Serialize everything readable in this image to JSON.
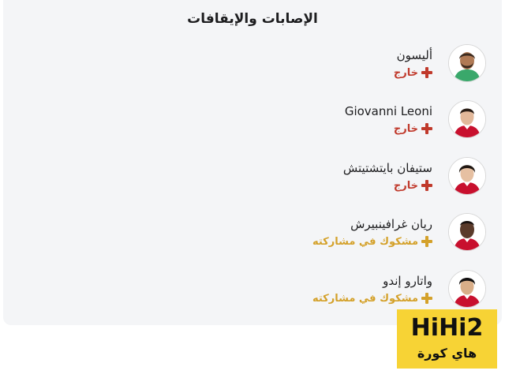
{
  "panel": {
    "title": "الإصابات والإيقافات",
    "players": [
      {
        "name": "أليسون",
        "status": "خارج",
        "status_type": "out",
        "kit": "green"
      },
      {
        "name": "Giovanni Leoni",
        "status": "خارج",
        "status_type": "out",
        "kit": "red"
      },
      {
        "name": "ستيفان بايتشتيتش",
        "status": "خارج",
        "status_type": "out",
        "kit": "red"
      },
      {
        "name": "ريان غرافينبيرش",
        "status": "مشكوك في مشاركته",
        "status_type": "doubtful",
        "kit": "red"
      },
      {
        "name": "واتارو إندو",
        "status": "مشكوك في مشاركته",
        "status_type": "doubtful",
        "kit": "red"
      }
    ]
  },
  "watermark": {
    "main": "HiHi2",
    "sub": "هاي كورة"
  },
  "colors": {
    "out": "#c0392b",
    "doubtful": "#d4a12a",
    "background": "#f4f5f7",
    "logo": "#f7d335"
  }
}
